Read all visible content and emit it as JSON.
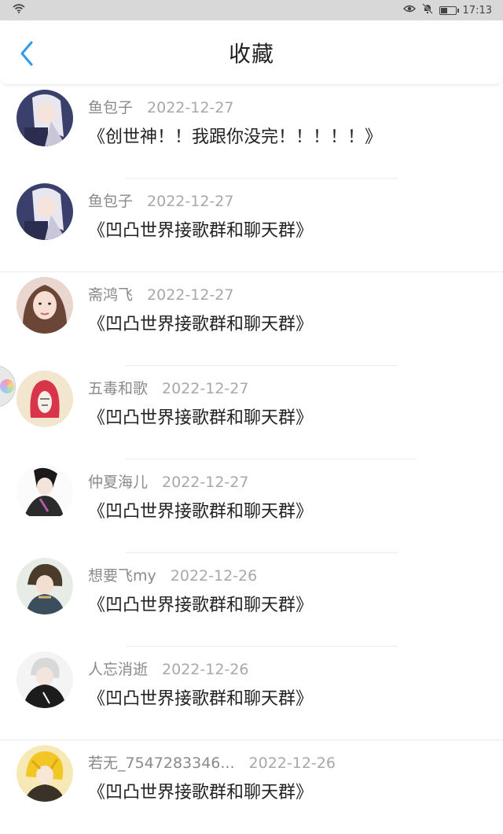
{
  "status_bar": {
    "time": "17:13",
    "icons": [
      "wifi-icon",
      "eye-icon",
      "mute-icon",
      "battery-icon"
    ]
  },
  "header": {
    "title": "收藏",
    "back_icon": "chevron-left-icon"
  },
  "colors": {
    "accent": "#2b9bf4",
    "text_primary": "#222222",
    "text_secondary": "#8a8a8a"
  },
  "favorites": [
    {
      "name": "鱼包子",
      "date": "2022-12-27",
      "content": "《创世神！！我跟你没完！！！！！》"
    },
    {
      "name": "鱼包子",
      "date": "2022-12-27",
      "content": "《凹凸世界接歌群和聊天群》"
    },
    {
      "name": "斋鸿飞",
      "date": "2022-12-27",
      "content": "《凹凸世界接歌群和聊天群》"
    },
    {
      "name": "五毒和歌",
      "date": "2022-12-27",
      "content": "《凹凸世界接歌群和聊天群》"
    },
    {
      "name": "仲夏海儿",
      "date": "2022-12-27",
      "content": "《凹凸世界接歌群和聊天群》"
    },
    {
      "name": "想要飞my",
      "date": "2022-12-26",
      "content": "《凹凸世界接歌群和聊天群》"
    },
    {
      "name": "人忘消逝",
      "date": "2022-12-26",
      "content": "《凹凸世界接歌群和聊天群》"
    },
    {
      "name": "若无_7547283346...",
      "date": "2022-12-26",
      "content": "《凹凸世界接歌群和聊天群》"
    }
  ]
}
